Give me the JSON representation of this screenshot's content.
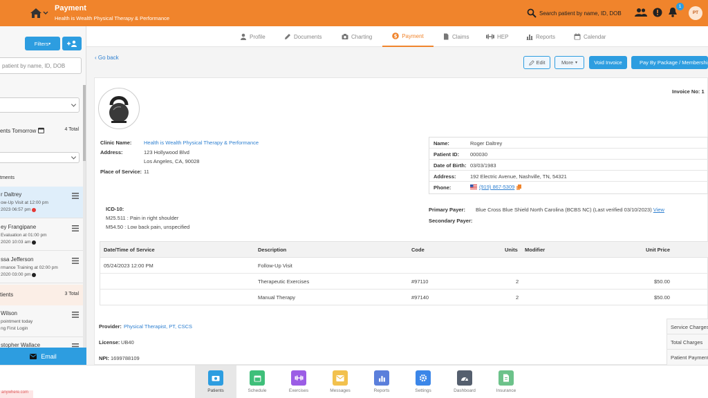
{
  "topbar": {
    "title": "Payment",
    "subtitle": "Health is Wealth Physical Therapy & Performance",
    "search_placeholder": "Search patient by name, ID, DOB",
    "notification_count": "1",
    "avatar_initials": "PT",
    "accent": "#f0842c"
  },
  "tabs": [
    {
      "label": "Profile",
      "icon": "person-icon"
    },
    {
      "label": "Documents",
      "icon": "pencil-icon"
    },
    {
      "label": "Charting",
      "icon": "camera-icon"
    },
    {
      "label": "Payment",
      "icon": "dollar-icon",
      "active": true
    },
    {
      "label": "Claims",
      "icon": "file-icon"
    },
    {
      "label": "HEP",
      "icon": "dumbbell-icon"
    },
    {
      "label": "Reports",
      "icon": "bar-chart-icon"
    },
    {
      "label": "Calendar",
      "icon": "calendar-icon"
    }
  ],
  "sidebar": {
    "filters_label": "Filters",
    "search_placeholder": "patient by name, ID, DOB",
    "section1_title": "ents Tomorrow",
    "section1_total": "4 Total",
    "appointments_label": "tments",
    "appointments": [
      {
        "name": "r Daltrey",
        "line2": "ow-Up Visit at 12:00 pm",
        "line3": "2023 06:57 pm",
        "dot": "#e53935"
      },
      {
        "name": "ey Frangipane",
        "line2": "Evaluation at 01:00 pm",
        "line3": "2020 10:03 am",
        "dot": "#222222"
      },
      {
        "name": "ssa Jefferson",
        "line2": "rmance Training at 02:00 pm",
        "line3": "2020 03:00 pm",
        "dot": "#222222"
      }
    ],
    "section2_title": "tients",
    "section2_total": "3 Total",
    "patients": [
      {
        "name": "Wilson",
        "line2": "pointment today",
        "line3": "ng First Login"
      },
      {
        "name": "stopher Wallace",
        "line2": "",
        "line3": ""
      }
    ],
    "email_label": "Email"
  },
  "actions": {
    "go_back": "Go back",
    "edit": "Edit",
    "more": "More",
    "void_invoice": "Void Invoice",
    "pay_package": "Pay By Package / Membership"
  },
  "invoice": {
    "invoice_no_label": "Invoice No: 1",
    "clinic_name_label": "Clinic Name:",
    "clinic_name": "Health is Wealth Physical Therapy & Performance",
    "address_label": "Address:",
    "address_line1": "123 Hollywood Blvd",
    "address_line2": "Los Angeles, CA, 90028",
    "place_of_service_label": "Place of Service:",
    "place_of_service": "11",
    "icd_label": "ICD-10:",
    "icd": [
      "M25.511 : Pain in right shoulder",
      "M54.50 : Low back pain, unspecified"
    ],
    "patient": {
      "name_label": "Name:",
      "name": "Roger Daltrey",
      "id_label": "Patient ID:",
      "id": "000030",
      "dob_label": "Date of Birth:",
      "dob": "03/03/1983",
      "address_label": "Address:",
      "address": "192 Electric Avenue, Nashville, TN, 54321",
      "phone_label": "Phone:",
      "phone": "(919) 867-5309"
    },
    "primary_payer_label": "Primary Payer:",
    "primary_payer": "Blue Cross Blue Shield North Carolina (BCBS NC) (Last verified 03/10/2023)",
    "primary_payer_link": "View",
    "secondary_payer_label": "Secondary Payer:",
    "table": {
      "headers": [
        "Date/Time of Service",
        "Description",
        "Code",
        "Units",
        "Modifier",
        "Unit Price"
      ],
      "rows": [
        {
          "date": "05/24/2023 12:00 PM",
          "description": "Follow-Up Visit",
          "code": "",
          "units": "",
          "price": ""
        },
        {
          "date": "",
          "description": "Therapeutic Exercises",
          "code": "#97110",
          "units": "2",
          "price": "$50.00"
        },
        {
          "date": "",
          "description": "Manual Therapy",
          "code": "#97140",
          "units": "2",
          "price": "$50.00"
        }
      ]
    },
    "provider_label": "Provider:",
    "provider": "Physical Therapist, PT, CSCS",
    "license_label": "License:",
    "license": "UB40",
    "npi_label": "NPI:",
    "npi": "1699788109",
    "summary": [
      "Service Charges",
      "Total Charges",
      "Patient Payments"
    ]
  },
  "bottomnav": [
    {
      "label": "Patients",
      "color": "#2d9de0",
      "active": true
    },
    {
      "label": "Schedule",
      "color": "#3fbf7a"
    },
    {
      "label": "Exercises",
      "color": "#9b5de5"
    },
    {
      "label": "Messages",
      "color": "#f2c14e"
    },
    {
      "label": "Reports",
      "color": "#5b7fdb"
    },
    {
      "label": "Settings",
      "color": "#3b86e8"
    },
    {
      "label": "Dashboard",
      "color": "#555f6e"
    },
    {
      "label": "Insurance",
      "color": "#6cc28a"
    }
  ],
  "footnote": "anywhere.com"
}
